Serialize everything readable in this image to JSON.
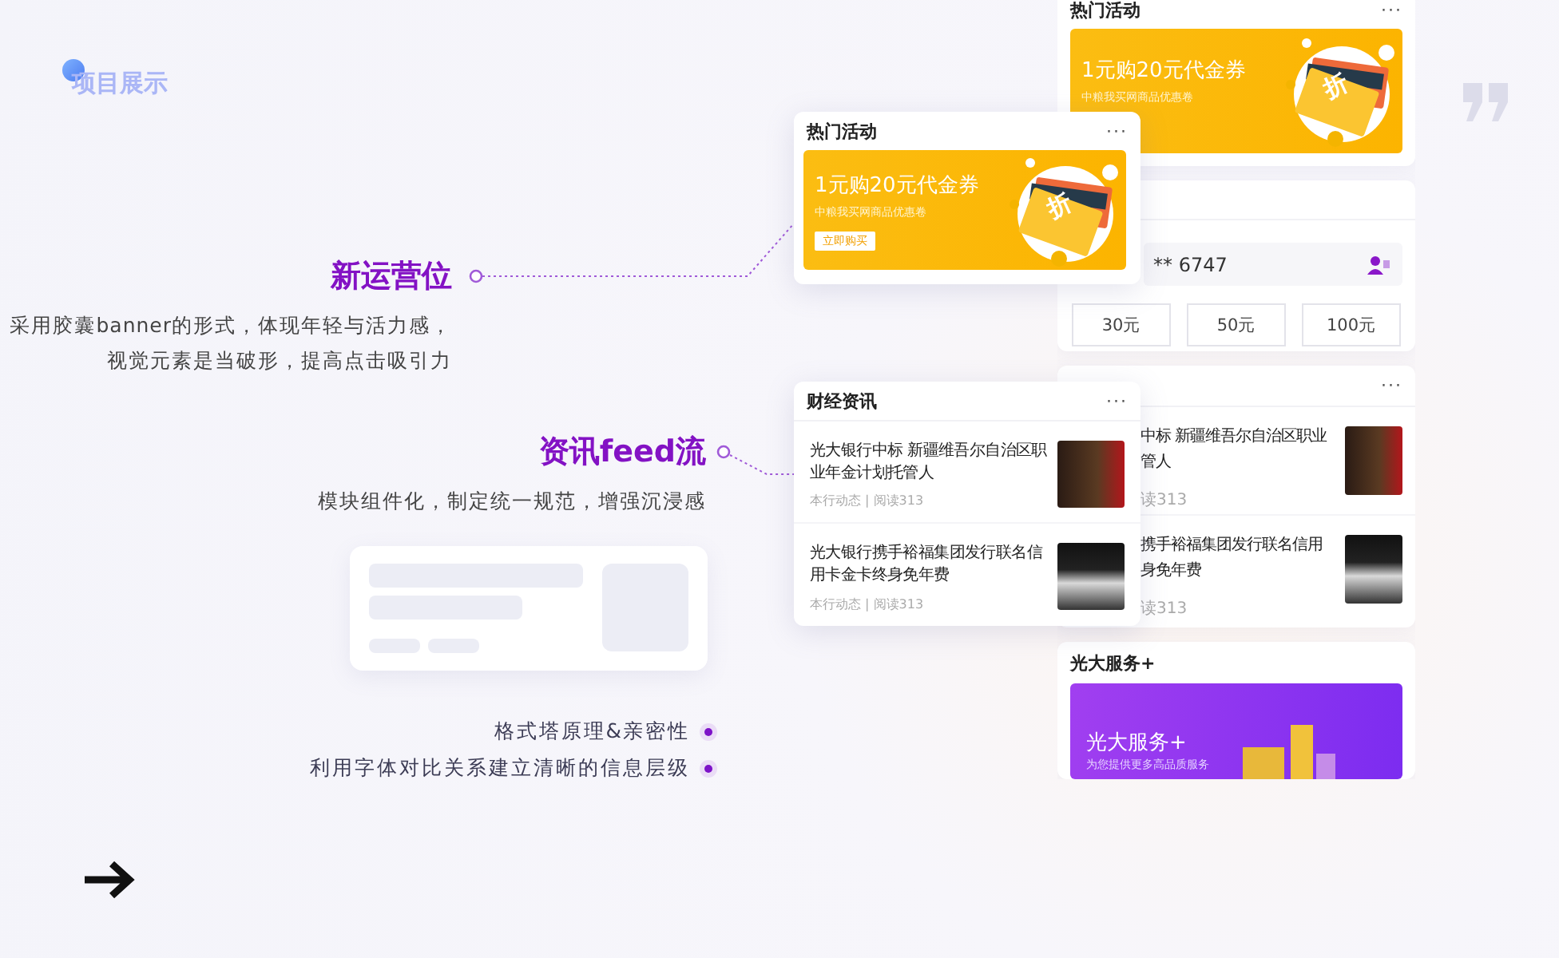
{
  "header": {
    "title": "项目展示"
  },
  "annotations": [
    {
      "title": "新运营位",
      "description": [
        "采用胶囊banner的形式，体现年轻与活力感，",
        "视觉元素是当破形，提高点击吸引力"
      ]
    },
    {
      "title": "资讯feed流",
      "description": [
        "模块组件化，制定统一规范，增强沉浸感"
      ]
    }
  ],
  "principles": [
    "格式塔原理&亲密性",
    "利用字体对比关系建立清晰的信息层级"
  ],
  "phone": {
    "promo_card": {
      "title": "热门活动",
      "more": "···",
      "banner": {
        "headline": "1元购20元代金券",
        "subtitle": "中粮我买网商品优惠卷",
        "badge": "折"
      }
    },
    "recharge_card": {
      "phone_number": "** 6747",
      "amounts": [
        "30元",
        "50元",
        "100元"
      ]
    },
    "news_card": {
      "more": "···",
      "items": [
        {
          "title_lines": [
            "中标 新疆维吾尔自治区职业",
            "管人"
          ],
          "meta": "读313"
        },
        {
          "title_lines": [
            "携手裕福集团发行联名信用",
            "身免年费"
          ],
          "meta": "读313"
        }
      ]
    },
    "service_card": {
      "title": "光大服务+",
      "banner": {
        "headline": "光大服务+",
        "subtitle": "为您提供更多高品质服务"
      }
    }
  },
  "zoom_promo": {
    "title": "热门活动",
    "more": "···",
    "banner": {
      "headline": "1元购20元代金券",
      "subtitle": "中粮我买网商品优惠卷",
      "button": "立即购买",
      "badge": "折"
    }
  },
  "zoom_news": {
    "title": "财经资讯",
    "more": "···",
    "items": [
      {
        "title": "光大银行中标 新疆维吾尔自治区职业年金计划托管人",
        "meta": "本行动态 | 阅读313"
      },
      {
        "title": "光大银行携手裕福集团发行联名信用卡金卡终身免年费",
        "meta": "本行动态 | 阅读313"
      }
    ]
  }
}
